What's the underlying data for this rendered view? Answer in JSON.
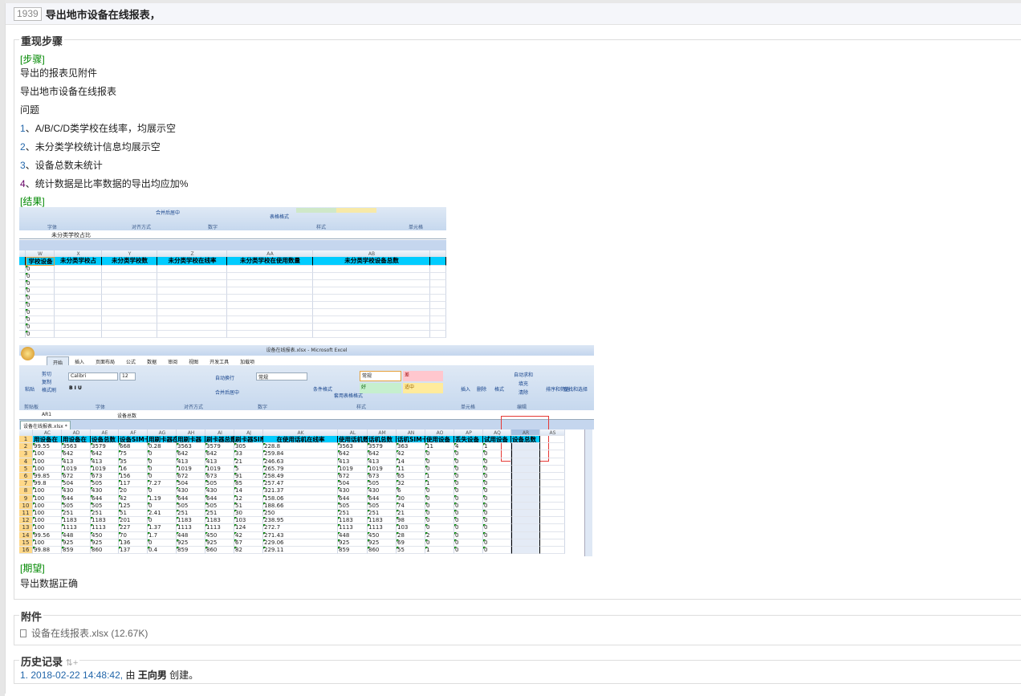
{
  "header": {
    "id": "1939",
    "title": "导出地市设备在线报表，"
  },
  "steps_section": {
    "legend": "重现步骤",
    "steps_tag": "[步骤]",
    "lines": [
      "导出的报表见附件",
      "导出地市设备在线报表",
      "问题"
    ],
    "issues": [
      {
        "num": "1",
        "text": "、A/B/C/D类学校在线率，均展示空"
      },
      {
        "num": "2",
        "text": "、未分类学校统计信息均展示空"
      },
      {
        "num": "3",
        "text": "、设备总数未统计"
      },
      {
        "num": "4",
        "text": "、统计数据是比率数据的导出均应加%"
      }
    ],
    "result_tag": "[结果]",
    "expect_tag": "[期望]",
    "expect_text": "导出数据正确"
  },
  "screenshot1": {
    "ribbon_groups": [
      "字体",
      "对齐方式",
      "数字",
      "样式",
      "单元格"
    ],
    "ribbon_buttons": [
      "合并后居中",
      "表格格式"
    ],
    "formula": "未分类学校占比",
    "col_letters": [
      "W",
      "X",
      "Y",
      "Z",
      "AA",
      "AB"
    ],
    "headers": [
      "学校设备",
      "未分类学校占",
      "未分类学校数",
      "未分类学校在线率",
      "未分类学校在使用数量",
      "未分类学校设备总数"
    ],
    "first_col_values": [
      "0",
      "0",
      "0",
      "0",
      "0",
      "0",
      "0",
      "0",
      "0",
      "0"
    ]
  },
  "screenshot2": {
    "window_title": "设备在线报表.xlsx - Microsoft Excel",
    "tabs": [
      "开始",
      "插入",
      "页面布局",
      "公式",
      "数据",
      "审阅",
      "视图",
      "开发工具",
      "加载项"
    ],
    "clipboard": [
      "粘贴",
      "剪切",
      "复制",
      "格式刷"
    ],
    "font_name": "Calibri",
    "font_size": "12",
    "number_format": "常规",
    "styles": {
      "normal": "常规",
      "bad": "差",
      "good": "好",
      "neutral": "适中"
    },
    "buttons": [
      "自动换行",
      "合并后居中",
      "条件格式",
      "套用表格格式",
      "插入",
      "删除",
      "格式",
      "自动求和",
      "填充",
      "清除",
      "排序和筛选",
      "查找和选择"
    ],
    "groups": [
      "剪贴板",
      "字体",
      "对齐方式",
      "数字",
      "样式",
      "单元格",
      "编辑"
    ],
    "name_box": "AR1",
    "formula": "设备总数",
    "sheet_tab": "设备在线报表.xlsx *",
    "col_letters": [
      "AC",
      "AD",
      "AE",
      "AF",
      "AG",
      "AH",
      "AI",
      "AJ",
      "AK",
      "AL",
      "AM",
      "AN",
      "AO",
      "AP",
      "AQ",
      "AR",
      "AS"
    ],
    "headers": [
      "用设备在",
      "用设备在",
      "设备总数",
      "设备SIM卡",
      "用刷卡器在",
      "用刷卡器",
      "刷卡器总数",
      "刷卡器SIM卡",
      "在使用话机在线率",
      "使用话机数",
      "话机总数",
      "话机SIM卡",
      "使用设备",
      "丢失设备",
      "试用设备",
      "设备总数",
      ""
    ],
    "rows": [
      [
        "99.55",
        "3563",
        "3579",
        "668",
        "0.28",
        "3563",
        "3579",
        "305",
        "228.8",
        "3563",
        "3579",
        "363",
        "11",
        "4",
        "1",
        "",
        ""
      ],
      [
        "100",
        "642",
        "642",
        "75",
        "0",
        "642",
        "642",
        "33",
        "259.84",
        "642",
        "642",
        "42",
        "0",
        "0",
        "0",
        "",
        ""
      ],
      [
        "100",
        "413",
        "413",
        "35",
        "0",
        "413",
        "413",
        "21",
        "246.63",
        "413",
        "413",
        "14",
        "0",
        "0",
        "0",
        "",
        ""
      ],
      [
        "100",
        "1019",
        "1019",
        "16",
        "0",
        "1019",
        "1019",
        "5",
        "265.79",
        "1019",
        "1019",
        "11",
        "0",
        "0",
        "0",
        "",
        ""
      ],
      [
        "99.85",
        "672",
        "673",
        "156",
        "0",
        "672",
        "673",
        "91",
        "258.49",
        "672",
        "673",
        "65",
        "1",
        "0",
        "0",
        "",
        ""
      ],
      [
        "99.8",
        "504",
        "505",
        "117",
        "7.27",
        "504",
        "505",
        "85",
        "257.47",
        "504",
        "505",
        "32",
        "1",
        "0",
        "0",
        "",
        ""
      ],
      [
        "100",
        "430",
        "430",
        "20",
        "0",
        "430",
        "430",
        "14",
        "321.37",
        "430",
        "430",
        "6",
        "0",
        "0",
        "0",
        "",
        ""
      ],
      [
        "100",
        "644",
        "644",
        "42",
        "1.19",
        "644",
        "644",
        "12",
        "158.06",
        "644",
        "644",
        "30",
        "0",
        "0",
        "0",
        "",
        ""
      ],
      [
        "100",
        "505",
        "505",
        "125",
        "0",
        "505",
        "505",
        "51",
        "188.66",
        "505",
        "505",
        "74",
        "0",
        "0",
        "0",
        "",
        ""
      ],
      [
        "100",
        "251",
        "251",
        "51",
        "2.41",
        "251",
        "251",
        "30",
        "250",
        "251",
        "251",
        "21",
        "0",
        "0",
        "0",
        "",
        ""
      ],
      [
        "100",
        "1183",
        "1183",
        "201",
        "0",
        "1183",
        "1183",
        "103",
        "238.95",
        "1183",
        "1183",
        "98",
        "0",
        "0",
        "0",
        "",
        ""
      ],
      [
        "100",
        "1113",
        "1113",
        "227",
        "1.37",
        "1113",
        "1113",
        "124",
        "272.7",
        "1113",
        "1113",
        "103",
        "0",
        "0",
        "0",
        "",
        ""
      ],
      [
        "99.56",
        "448",
        "450",
        "70",
        "1.7",
        "448",
        "450",
        "42",
        "271.43",
        "448",
        "450",
        "28",
        "2",
        "0",
        "0",
        "",
        ""
      ],
      [
        "100",
        "925",
        "925",
        "136",
        "0",
        "925",
        "925",
        "67",
        "229.06",
        "925",
        "925",
        "69",
        "0",
        "0",
        "0",
        "",
        ""
      ],
      [
        "99.88",
        "859",
        "860",
        "137",
        "0.4",
        "859",
        "860",
        "82",
        "229.11",
        "859",
        "860",
        "55",
        "1",
        "0",
        "0",
        "",
        ""
      ]
    ],
    "highlight_color": "#e53935"
  },
  "attachments": {
    "legend": "附件",
    "file": "设备在线报表.xlsx (12.67K)"
  },
  "history": {
    "legend": "历史记录",
    "entry_num": "1. 2018-02-22 14:48:42,",
    "by": "由",
    "user": "王向男",
    "action": "创建。"
  }
}
